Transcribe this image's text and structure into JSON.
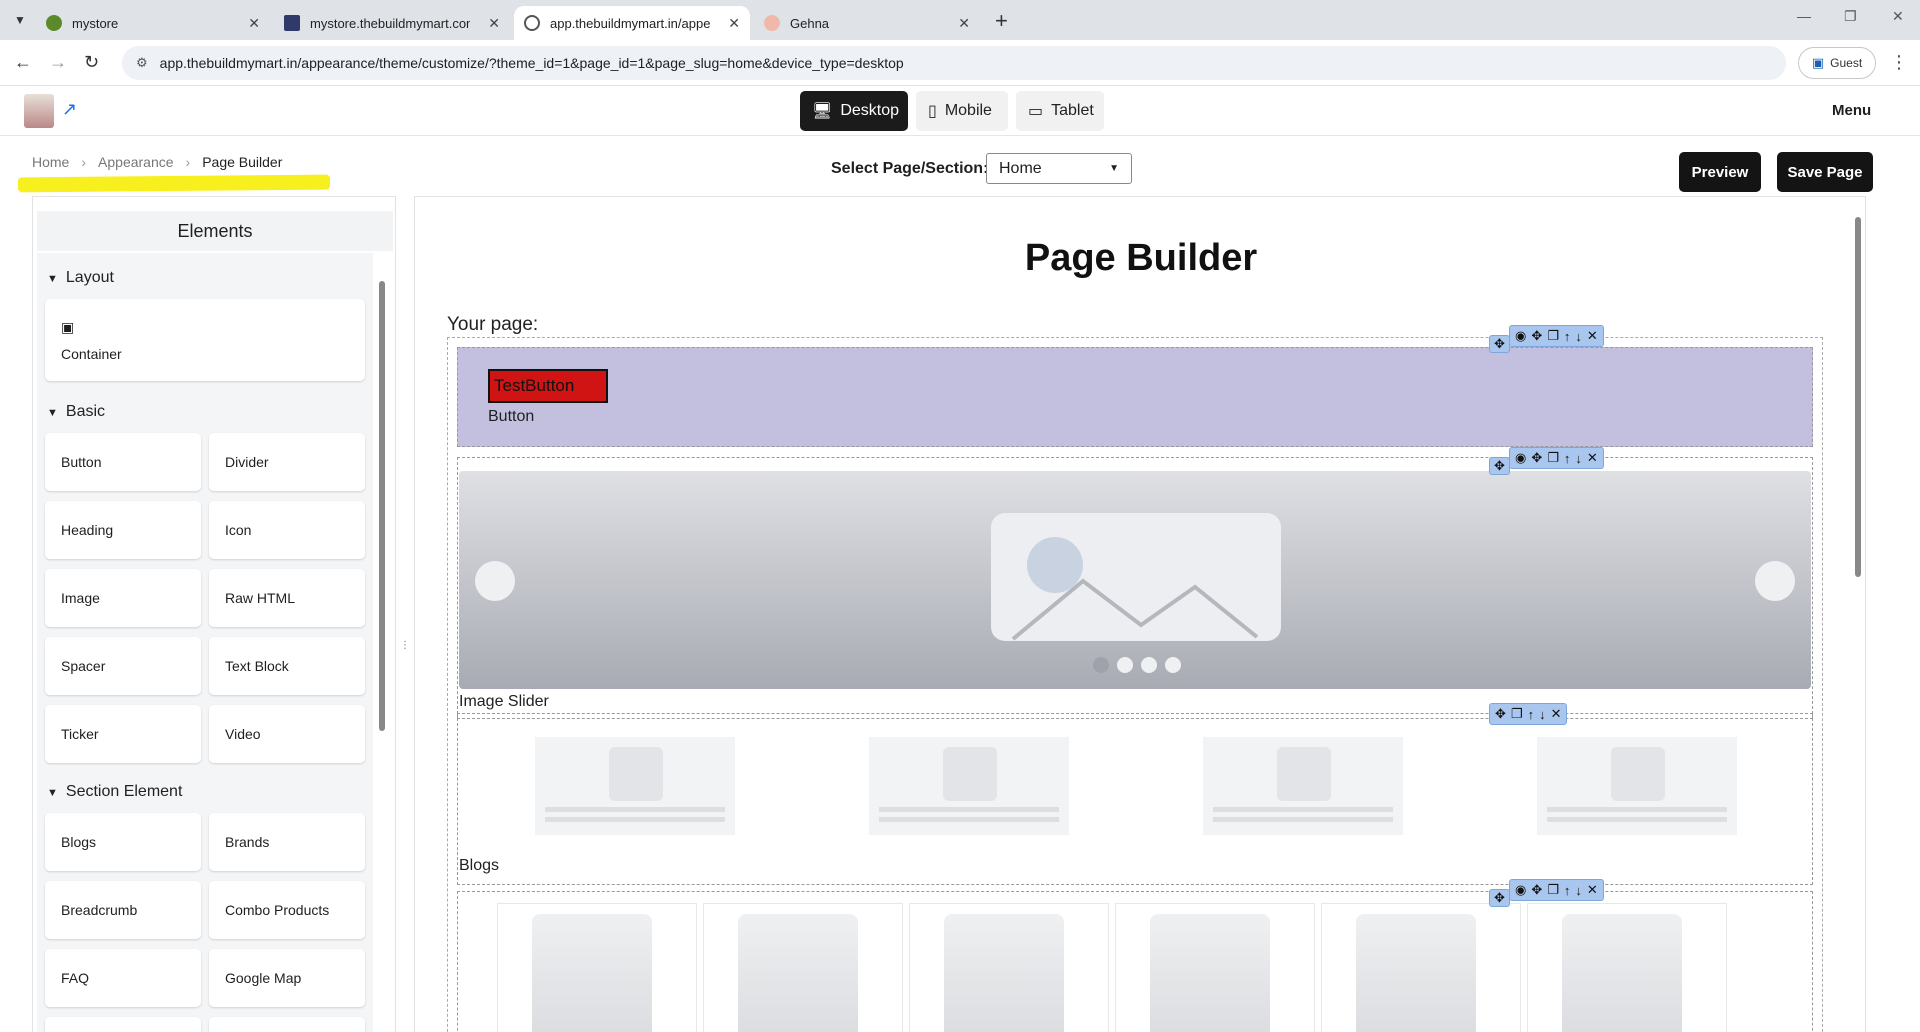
{
  "browser": {
    "tabs": [
      {
        "title": "mystore",
        "active": false
      },
      {
        "title": "mystore.thebuildmymart.com",
        "active": false
      },
      {
        "title": "app.thebuildmymart.in/appeara",
        "active": true
      },
      {
        "title": "Gehna",
        "active": false
      }
    ],
    "url": "app.thebuildmymart.in/appearance/theme/customize/?theme_id=1&page_id=1&page_slug=home&device_type=desktop",
    "profile_label": "Guest"
  },
  "header": {
    "devices": [
      "Desktop",
      "Mobile",
      "Tablet"
    ],
    "active_device": "Desktop",
    "menu_label": "Menu"
  },
  "breadcrumb": [
    "Home",
    "Appearance",
    "Page Builder"
  ],
  "page_select": {
    "label": "Select Page/Section:",
    "value": "Home"
  },
  "actions": {
    "preview": "Preview",
    "save": "Save Page"
  },
  "elements_panel": {
    "title": "Elements",
    "groups": [
      {
        "name": "Layout",
        "items": [
          "Container"
        ]
      },
      {
        "name": "Basic",
        "items": [
          "Button",
          "Divider",
          "Heading",
          "Icon",
          "Image",
          "Raw HTML",
          "Spacer",
          "Text Block",
          "Ticker",
          "Video"
        ]
      },
      {
        "name": "Section Element",
        "items": [
          "Blogs",
          "Brands",
          "Breadcrumb",
          "Combo Products",
          "FAQ",
          "Google Map"
        ]
      }
    ]
  },
  "canvas": {
    "title": "Page Builder",
    "your_page": "Your page:",
    "button_text": "TestButton",
    "button_label": "Button",
    "slider_label": "Image Slider",
    "blogs_label": "Blogs"
  },
  "colors": {
    "accent_highlight": "#f7ef1e",
    "section_bg": "#c3c0df",
    "test_button": "#d01414",
    "dark_button": "#141414"
  }
}
